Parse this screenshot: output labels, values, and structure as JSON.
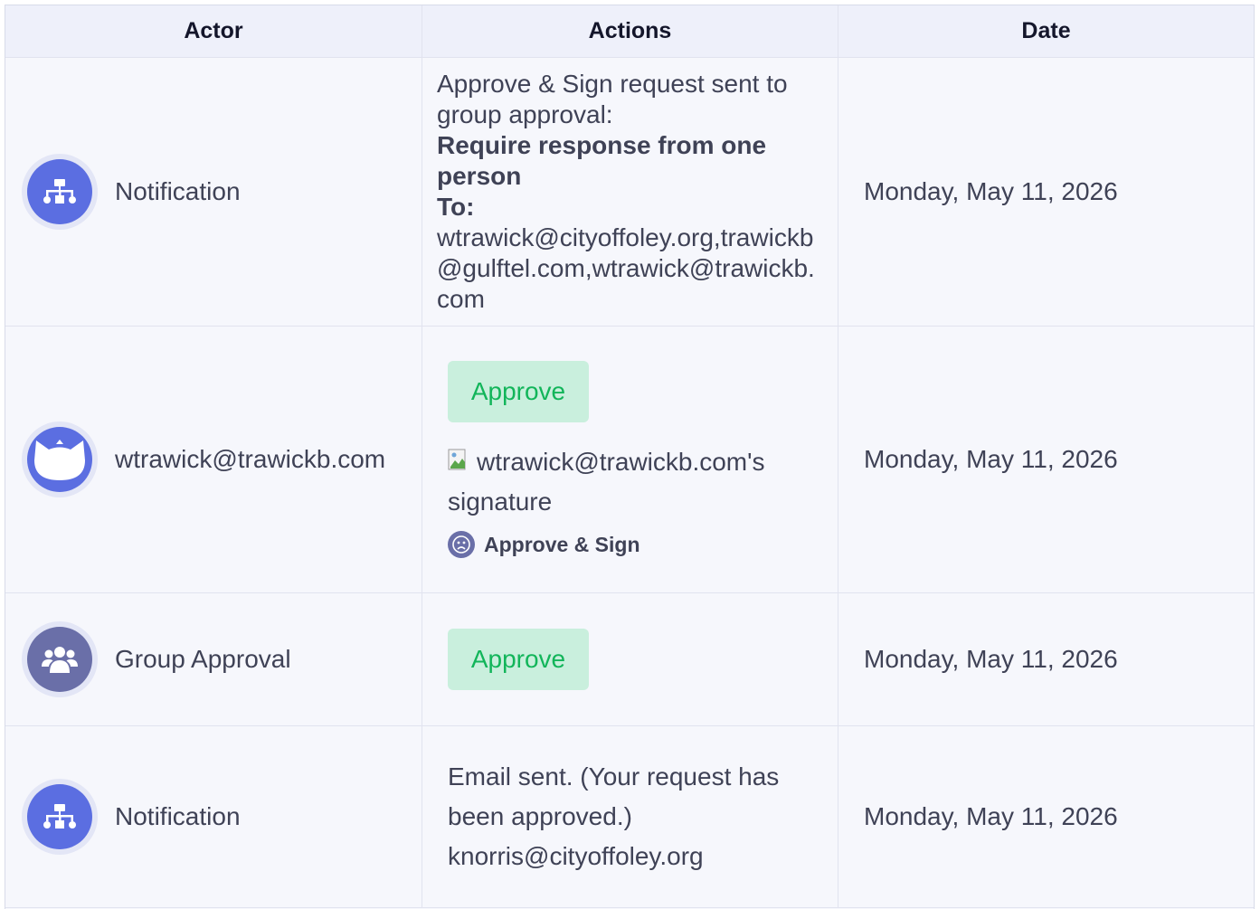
{
  "table": {
    "headers": {
      "actor": "Actor",
      "actions": "Actions",
      "date": "Date"
    },
    "rows": [
      {
        "actor": "Notification",
        "actor_icon": "sitemap-icon",
        "action_line1": "Approve & Sign request sent to group approval:",
        "action_bold1": "Require response from one person",
        "action_bold2": "To:",
        "action_emails": "wtrawick@cityoffoley.org,trawickb@gulftel.com,wtrawick@trawickb.com",
        "date": "Monday, May 11, 2026"
      },
      {
        "actor": "wtrawick@trawickb.com",
        "actor_icon": "cat-face-icon",
        "approve_label": "Approve",
        "signature_alt": "wtrawick@trawickb.com's signature",
        "sign_label": "Approve & Sign",
        "date": "Monday, May 11, 2026"
      },
      {
        "actor": "Group Approval",
        "actor_icon": "users-icon",
        "approve_label": "Approve",
        "date": "Monday, May 11, 2026"
      },
      {
        "actor": "Notification",
        "actor_icon": "sitemap-icon",
        "email_text": "Email sent. (Your request has been approved.) knorris@cityoffoley.org",
        "date": "Monday, May 11, 2026"
      }
    ]
  },
  "colors": {
    "avatar_blue": "#5b6ee1",
    "avatar_slate": "#6a6fa8",
    "approve_bg": "#c9efdd",
    "approve_text": "#12b55a",
    "text": "#3f4256"
  }
}
